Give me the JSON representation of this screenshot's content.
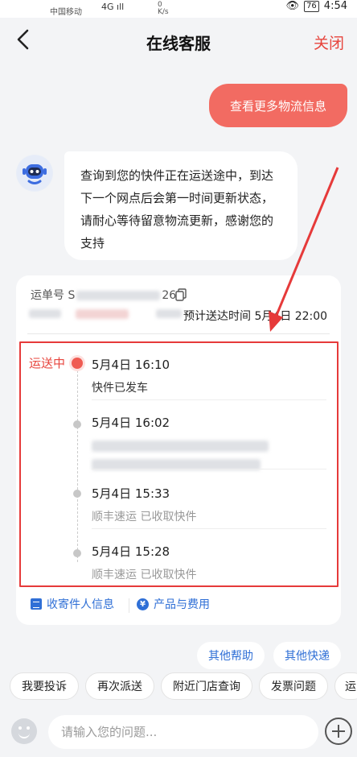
{
  "status_bar": {
    "carrier": "中国移动",
    "signal": "4G ıll",
    "speed": "0\nK/s",
    "battery": "76",
    "time": "4:54"
  },
  "header": {
    "title": "在线客服",
    "close_label": "关闭"
  },
  "chat": {
    "user_message": "查看更多物流信息",
    "bot_message": "查询到您的快件正在运送途中，到达下一个网点后会第一时间更新状态，请耐心等待留意物流更新，感谢您的支持"
  },
  "tracking": {
    "waybill_label": "运单号 S",
    "waybill_suffix": "26",
    "eta_label": "预计送达时间 5月4日 22:00",
    "status": "运送中",
    "events": [
      {
        "time": "5月4日 16:10",
        "desc": "快件已发车"
      },
      {
        "time": "5月4日 16:02",
        "desc": ""
      },
      {
        "time": "5月4日 15:33",
        "desc": "顺丰速运 已收取快件"
      },
      {
        "time": "5月4日 15:28",
        "desc": "顺丰速运 已收取快件"
      }
    ],
    "actions": {
      "sender_info": "收寄件人信息",
      "products_fees": "产品与费用"
    }
  },
  "quick_replies": {
    "row1": [
      "其他帮助",
      "其他快递"
    ],
    "row2": [
      "我要投诉",
      "再次派送",
      "附近门店查询",
      "发票问题",
      "运"
    ]
  },
  "input": {
    "placeholder": "请输入您的问题..."
  },
  "colors": {
    "accent": "#e7443c",
    "link": "#2f6fd6",
    "user_bubble": "#f26b62"
  }
}
